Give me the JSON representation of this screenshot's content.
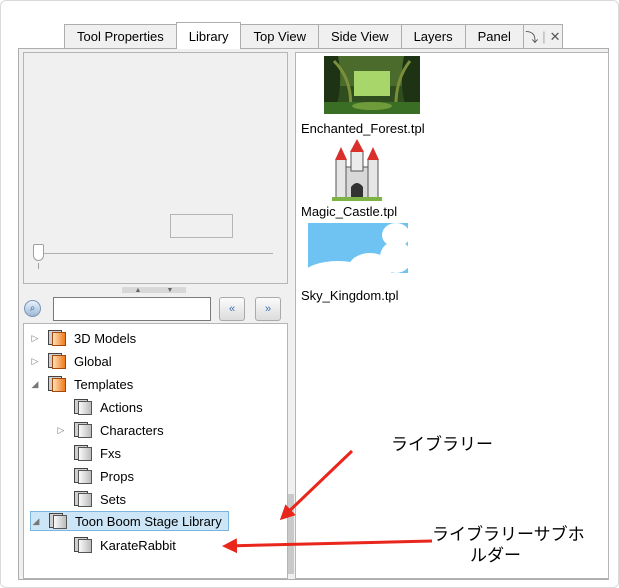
{
  "tabs": [
    {
      "label": "Tool Properties",
      "active": false
    },
    {
      "label": "Library",
      "active": true
    },
    {
      "label": "Top View",
      "active": false
    },
    {
      "label": "Side View",
      "active": false
    },
    {
      "label": "Layers",
      "active": false
    },
    {
      "label": "Panel",
      "active": false
    }
  ],
  "tab_controls": {
    "pin_glyph": "⤵",
    "close_glyph": "✕",
    "separator": "|"
  },
  "search": {
    "value": "",
    "placeholder": ""
  },
  "nav": {
    "back_glyph": "«",
    "forward_glyph": "»"
  },
  "slider": {
    "value": 0
  },
  "tree": {
    "items": [
      {
        "label": "3D Models",
        "level": 0,
        "expander": "▷",
        "folder": "orange"
      },
      {
        "label": "Global",
        "level": 0,
        "expander": "▷",
        "folder": "orange"
      },
      {
        "label": "Templates",
        "level": 0,
        "expander": "◢",
        "folder": "orange"
      },
      {
        "label": "Actions",
        "level": 1,
        "expander": "",
        "folder": "gray"
      },
      {
        "label": "Characters",
        "level": 1,
        "expander": "▷",
        "folder": "gray"
      },
      {
        "label": "Fxs",
        "level": 1,
        "expander": "",
        "folder": "gray"
      },
      {
        "label": "Props",
        "level": 1,
        "expander": "",
        "folder": "gray"
      },
      {
        "label": "Sets",
        "level": 1,
        "expander": "",
        "folder": "gray"
      },
      {
        "label": "Toon Boom Stage Library",
        "level": 0,
        "expander": "◢",
        "folder": "gray",
        "selected": true
      },
      {
        "label": "KarateRabbit",
        "level": 1,
        "expander": "",
        "folder": "gray"
      }
    ]
  },
  "templates": [
    {
      "label": "Enchanted_Forest.tpl",
      "icon": "forest-thumbnail"
    },
    {
      "label": "Magic_Castle.tpl",
      "icon": "castle-thumbnail"
    },
    {
      "label": "Sky_Kingdom.tpl",
      "icon": "sky-thumbnail"
    }
  ],
  "callouts": {
    "library": "ライブラリー",
    "subfolder_line1": "ライブラリーサブホ",
    "subfolder_line2": "ルダー"
  },
  "colors": {
    "arrow": "#e8261c",
    "selection": "#cde6f7",
    "selection_border": "#7bb4df"
  }
}
